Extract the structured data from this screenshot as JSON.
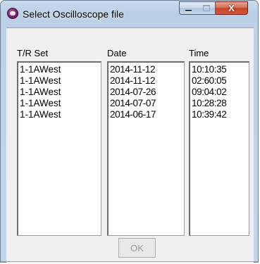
{
  "window": {
    "title": "Select Oscilloscope file",
    "close_symbol": "X",
    "icon": "oscilloscope-app-icon"
  },
  "columns": {
    "trset_header": "T/R Set",
    "date_header": "Date",
    "time_header": "Time"
  },
  "rows": [
    {
      "trset": "1-1AWest",
      "date": "2014-11-12",
      "time": "10:10:35"
    },
    {
      "trset": "1-1AWest",
      "date": "2014-11-12",
      "time": "02:60:05"
    },
    {
      "trset": "1-1AWest",
      "date": "2014-07-26",
      "time": "09:04:02"
    },
    {
      "trset": "1-1AWest",
      "date": "2014-07-07",
      "time": "10:28:28"
    },
    {
      "trset": "1-1AWest",
      "date": "2014-06-17",
      "time": "10:39:42"
    }
  ],
  "buttons": {
    "ok_label": "OK",
    "ok_enabled": false
  },
  "colors": {
    "titlebar_accent": "#b9cfe6",
    "close_button": "#c5442a",
    "disabled_text": "#9a9a9a"
  }
}
